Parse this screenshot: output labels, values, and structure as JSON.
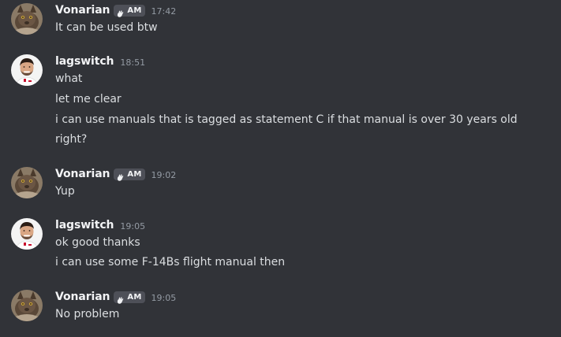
{
  "messages": [
    {
      "author": "Vonarian",
      "tag": "AM",
      "time": "17:42",
      "lines": [
        "It can be used btw"
      ]
    },
    {
      "author": "lagswitch",
      "time": "18:51",
      "lines": [
        "what",
        "let me clear",
        "i can use manuals that is tagged as statement C if that manual is over 30 years old",
        "right?"
      ]
    },
    {
      "author": "Vonarian",
      "tag": "AM",
      "time": "19:02",
      "lines": [
        "Yup"
      ]
    },
    {
      "author": "lagswitch",
      "time": "19:05",
      "lines": [
        "ok good thanks",
        "i can use some F-14Bs flight manual then"
      ]
    },
    {
      "author": "Vonarian",
      "tag": "AM",
      "time": "19:05",
      "lines": [
        "No problem"
      ]
    }
  ],
  "colors": {
    "background": "#313338",
    "username": "#f2f3f5",
    "message_text": "#dbdee1",
    "timestamp": "#949ba4",
    "tag_background": "#4e5058"
  },
  "icons": {
    "tag_icon": "hand-wave-icon",
    "vonarian_avatar": "cat-avatar",
    "lagswitch_avatar": "driver-photo-avatar"
  }
}
